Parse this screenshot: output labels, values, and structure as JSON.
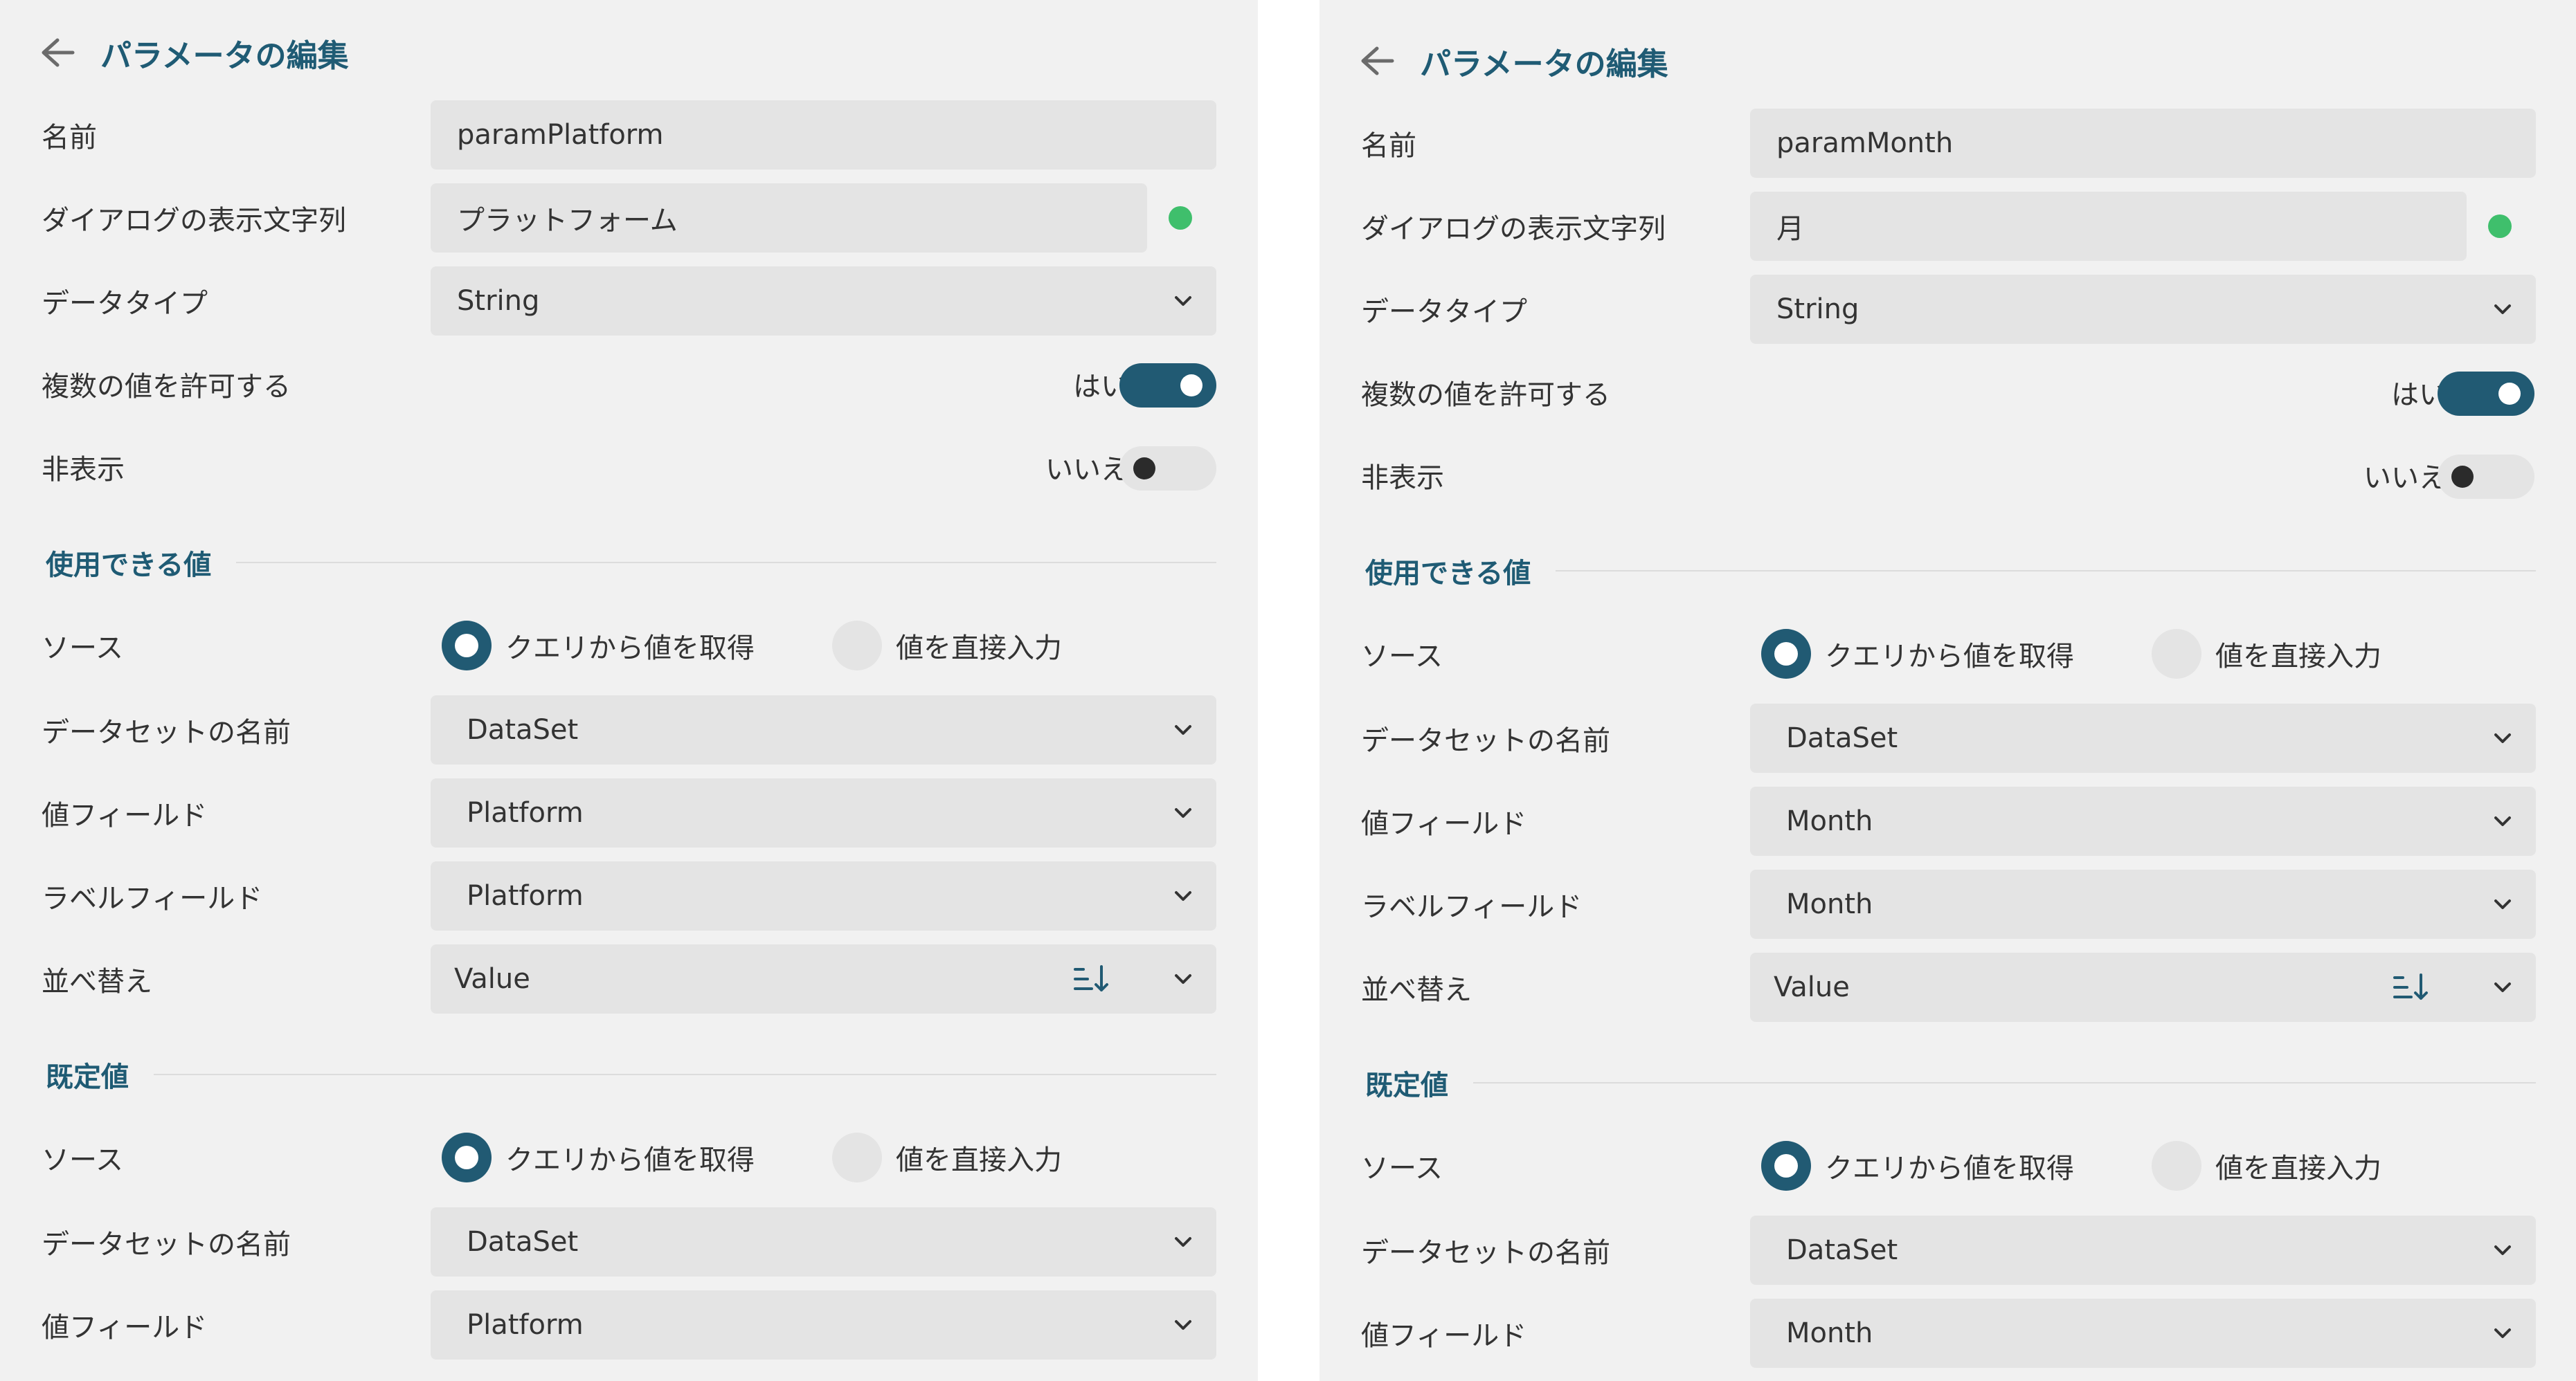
{
  "panels": [
    {
      "title": "パラメータの編集",
      "name_label": "名前",
      "name_value": "paramPlatform",
      "prompt_label": "ダイアログの表示文字列",
      "prompt_value": "プラットフォーム",
      "datatype_label": "データタイプ",
      "datatype_value": "String",
      "multi_label": "複数の値を許可する",
      "multi_state": "はい",
      "hidden_label": "非表示",
      "hidden_state": "いいえ",
      "available_section": "使用できる値",
      "source_label": "ソース",
      "source_opt_query": "クエリから値を取得",
      "source_opt_manual": "値を直接入力",
      "dataset_label": "データセットの名前",
      "dataset_value": "DataSet",
      "value_field_label": "値フィールド",
      "value_field_value": "Platform",
      "label_field_label": "ラベルフィールド",
      "label_field_value": "Platform",
      "sort_label": "並べ替え",
      "sort_value": "Value",
      "default_section": "既定値",
      "def_source_label": "ソース",
      "def_source_opt_query": "クエリから値を取得",
      "def_source_opt_manual": "値を直接入力",
      "def_dataset_label": "データセットの名前",
      "def_dataset_value": "DataSet",
      "def_value_field_label": "値フィールド",
      "def_value_field_value": "Platform"
    },
    {
      "title": "パラメータの編集",
      "name_label": "名前",
      "name_value": "paramMonth",
      "prompt_label": "ダイアログの表示文字列",
      "prompt_value": "月",
      "datatype_label": "データタイプ",
      "datatype_value": "String",
      "multi_label": "複数の値を許可する",
      "multi_state": "はい",
      "hidden_label": "非表示",
      "hidden_state": "いいえ",
      "available_section": "使用できる値",
      "source_label": "ソース",
      "source_opt_query": "クエリから値を取得",
      "source_opt_manual": "値を直接入力",
      "dataset_label": "データセットの名前",
      "dataset_value": "DataSet",
      "value_field_label": "値フィールド",
      "value_field_value": "Month",
      "label_field_label": "ラベルフィールド",
      "label_field_value": "Month",
      "sort_label": "並べ替え",
      "sort_value": "Value",
      "default_section": "既定値",
      "def_source_label": "ソース",
      "def_source_opt_query": "クエリから値を取得",
      "def_source_opt_manual": "値を直接入力",
      "def_dataset_label": "データセットの名前",
      "def_dataset_value": "DataSet",
      "def_value_field_label": "値フィールド",
      "def_value_field_value": "Month"
    }
  ],
  "icons": {
    "back": "arrow-left-icon",
    "dropdown": "chevron-down-icon",
    "sort": "sort-ascending-icon",
    "status": "status-dot"
  },
  "colors": {
    "accent": "#215a73",
    "title": "#1f5b74",
    "status_green": "#3fbf6c",
    "panel_bg": "#f1f1f1",
    "field_bg": "#e4e4e4"
  },
  "state": {
    "multi_enabled": true,
    "hidden_enabled": false,
    "available_source_selected": "query",
    "default_source_selected": "query"
  }
}
